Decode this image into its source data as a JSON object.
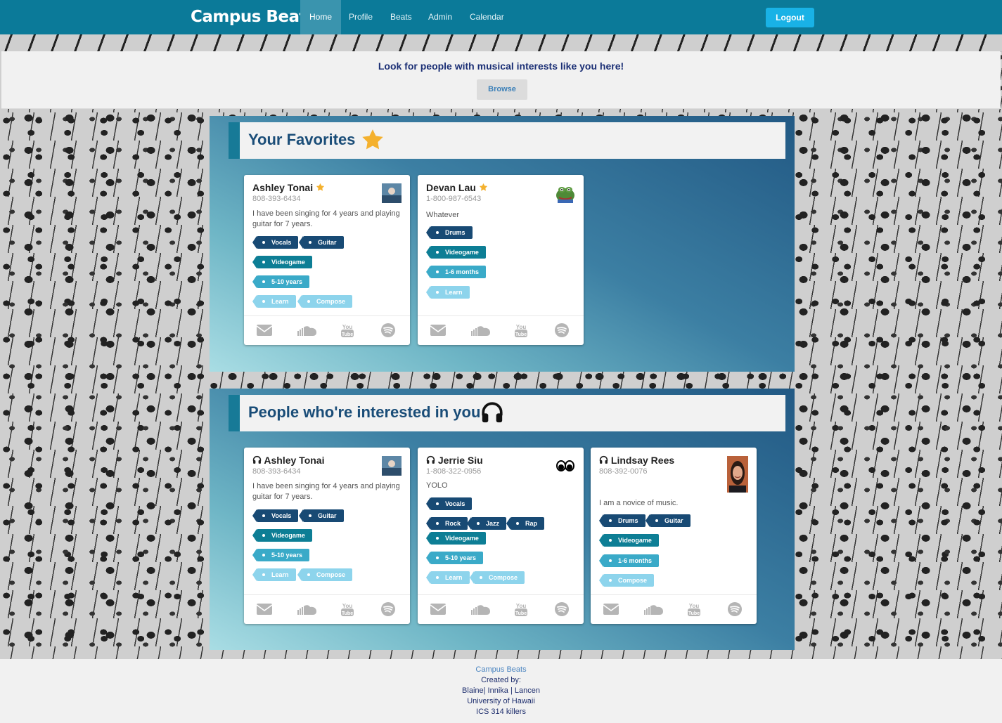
{
  "nav": {
    "brand": "Campus Beats",
    "items": [
      "Home",
      "Profile",
      "Beats",
      "Admin",
      "Calendar"
    ],
    "logout": "Logout"
  },
  "banner": {
    "text": "Look for people with musical interests like you here!",
    "browse": "Browse"
  },
  "favorites": {
    "title": "Your Favorites",
    "icon": "star-icon",
    "cards": [
      {
        "name": "Ashley Tonai",
        "phone": "808-393-6434",
        "bio": "I have been singing for 4 years and playing guitar for 7 years.",
        "tags": [
          "Vocals",
          "Guitar",
          "Videogame",
          "5-10 years",
          "Learn",
          "Compose"
        ]
      },
      {
        "name": "Devan Lau",
        "phone": "1-800-987-6543",
        "bio": "Whatever",
        "tags": [
          "Drums",
          "Videogame",
          "1-6 months",
          "Learn"
        ]
      }
    ]
  },
  "interested": {
    "title": "People who're interested in you",
    "icon": "headphones-icon",
    "cards": [
      {
        "name": "Ashley Tonai",
        "phone": "808-393-6434",
        "bio": "I have been singing for 4 years and playing guitar for 7 years.",
        "tags": [
          "Vocals",
          "Guitar",
          "Videogame",
          "5-10 years",
          "Learn",
          "Compose"
        ]
      },
      {
        "name": "Jerrie Siu",
        "phone": "1-808-322-0956",
        "bio": "YOLO",
        "tags": [
          "Vocals",
          "Rock",
          "Jazz",
          "Rap",
          "Videogame",
          "5-10 years",
          "Learn",
          "Compose"
        ]
      },
      {
        "name": "Lindsay Rees",
        "phone": "808-392-0076",
        "bio": "I am a novice of music.",
        "tags": [
          "Drums",
          "Guitar",
          "Videogame",
          "1-6 months",
          "Compose"
        ]
      }
    ]
  },
  "card_footer_icons": [
    "envelope-icon",
    "soundcloud-icon",
    "youtube-icon",
    "spotify-icon"
  ],
  "footer": {
    "brand": "Campus Beats",
    "created_by": "Created by:",
    "authors": "Blaine| Innika | Lancen",
    "school": "University of Hawaii",
    "course": "ICS 314 killers"
  }
}
